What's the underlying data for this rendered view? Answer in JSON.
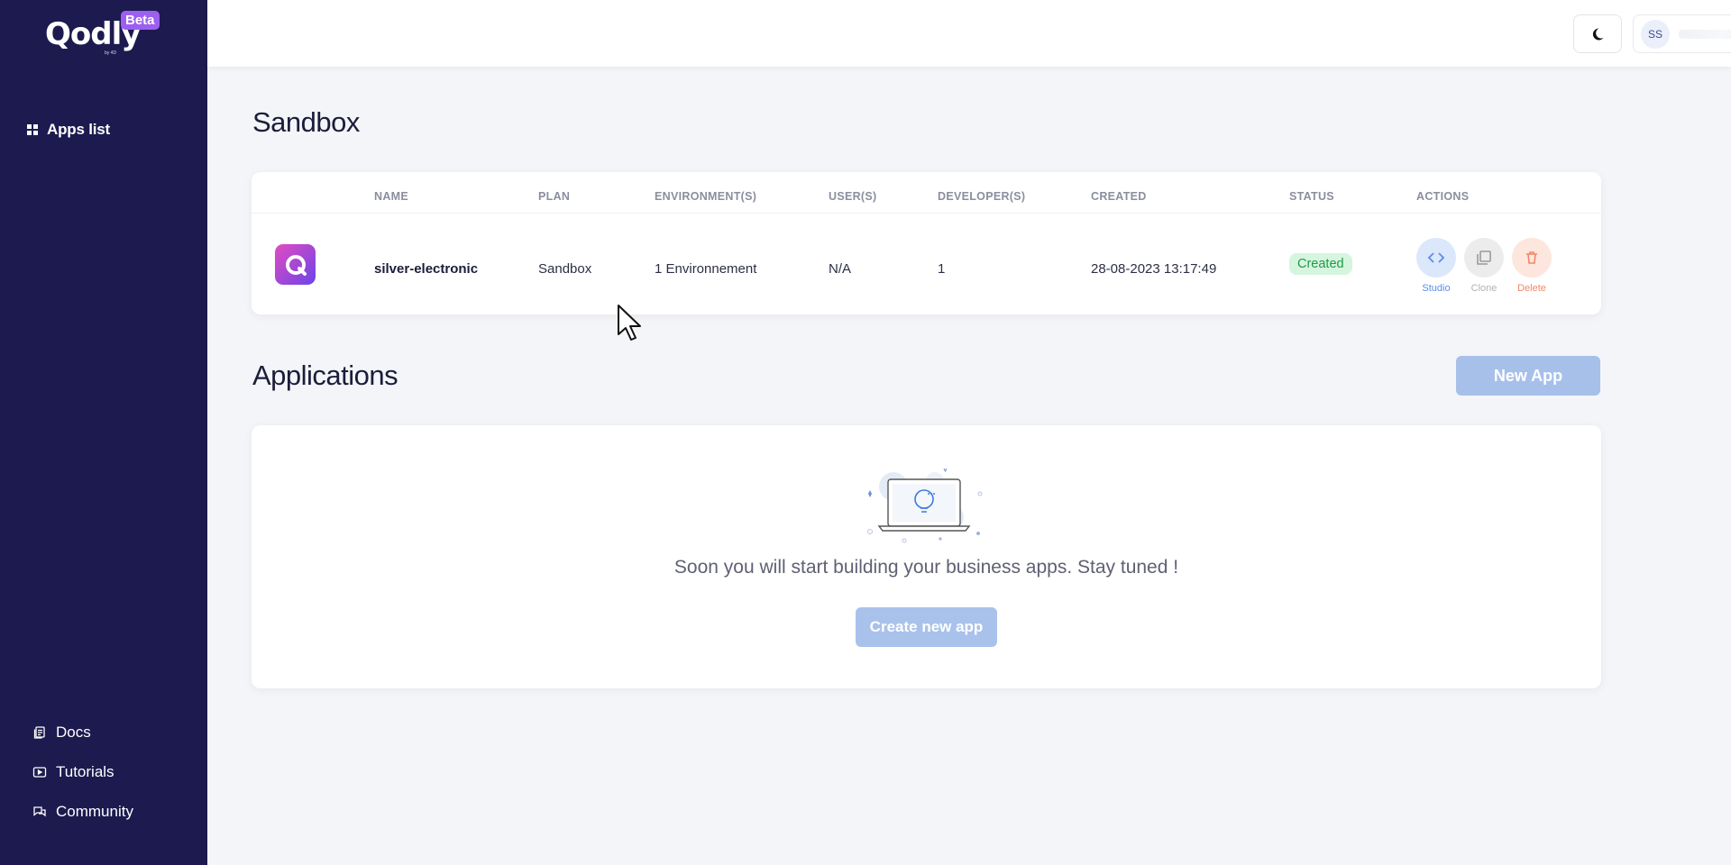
{
  "brand": {
    "name": "Qodly",
    "sub": "by 4D",
    "badge": "Beta"
  },
  "sidebar": {
    "apps_list": "Apps list",
    "docs": "Docs",
    "tutorials": "Tutorials",
    "community": "Community"
  },
  "topbar": {
    "avatar_initials": "SS"
  },
  "sandbox": {
    "title": "Sandbox",
    "columns": [
      "NAME",
      "PLAN",
      "ENVIRONMENT(S)",
      "USER(S)",
      "DEVELOPER(S)",
      "CREATED",
      "STATUS",
      "ACTIONS"
    ],
    "row": {
      "name": "silver-electronic",
      "plan": "Sandbox",
      "environments": "1 Environnement",
      "users": "N/A",
      "developers": "1",
      "created": "28-08-2023 13:17:49",
      "status": "Created"
    },
    "actions": {
      "studio": "Studio",
      "clone": "Clone",
      "delete": "Delete"
    }
  },
  "applications": {
    "title": "Applications",
    "new_app": "New App",
    "empty_message": "Soon you will start building your business apps. Stay tuned !",
    "create_new_app": "Create new app"
  },
  "colors": {
    "sidebar_bg": "#1c1a4f",
    "accent": "#a7c0ea",
    "status_bg": "#d6f5df",
    "status_text": "#1f9a49"
  }
}
